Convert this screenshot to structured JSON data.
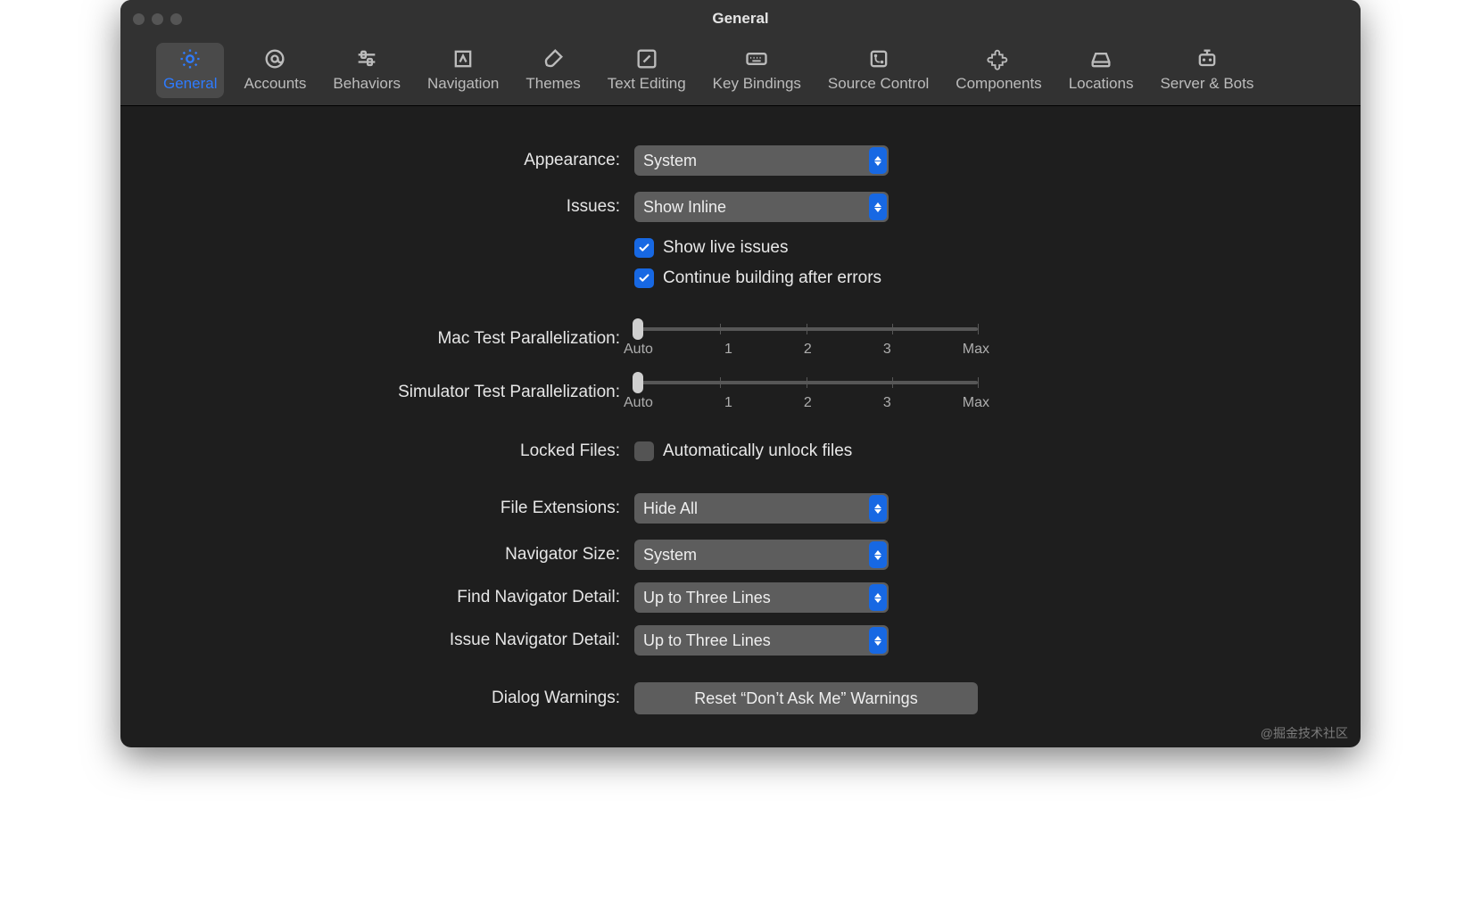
{
  "window": {
    "title": "General"
  },
  "tabs": [
    {
      "label": "General"
    },
    {
      "label": "Accounts"
    },
    {
      "label": "Behaviors"
    },
    {
      "label": "Navigation"
    },
    {
      "label": "Themes"
    },
    {
      "label": "Text Editing"
    },
    {
      "label": "Key Bindings"
    },
    {
      "label": "Source Control"
    },
    {
      "label": "Components"
    },
    {
      "label": "Locations"
    },
    {
      "label": "Server & Bots"
    }
  ],
  "labels": {
    "appearance": "Appearance:",
    "issues": "Issues:",
    "macTest": "Mac Test Parallelization:",
    "simTest": "Simulator Test Parallelization:",
    "locked": "Locked Files:",
    "fileExt": "File Extensions:",
    "navSize": "Navigator Size:",
    "findNav": "Find Navigator Detail:",
    "issueNav": "Issue Navigator Detail:",
    "dialog": "Dialog Warnings:"
  },
  "values": {
    "appearance": "System",
    "issues": "Show Inline",
    "showLive": "Show live issues",
    "continueBuild": "Continue building after errors",
    "autoUnlock": "Automatically unlock files",
    "fileExt": "Hide All",
    "navSize": "System",
    "findNav": "Up to Three Lines",
    "issueNav": "Up to Three Lines",
    "resetWarnings": "Reset “Don’t Ask Me” Warnings"
  },
  "sliderTicks": {
    "t0": "Auto",
    "t1": "1",
    "t2": "2",
    "t3": "3",
    "t4": "Max"
  },
  "watermark": "@掘金技术社区"
}
